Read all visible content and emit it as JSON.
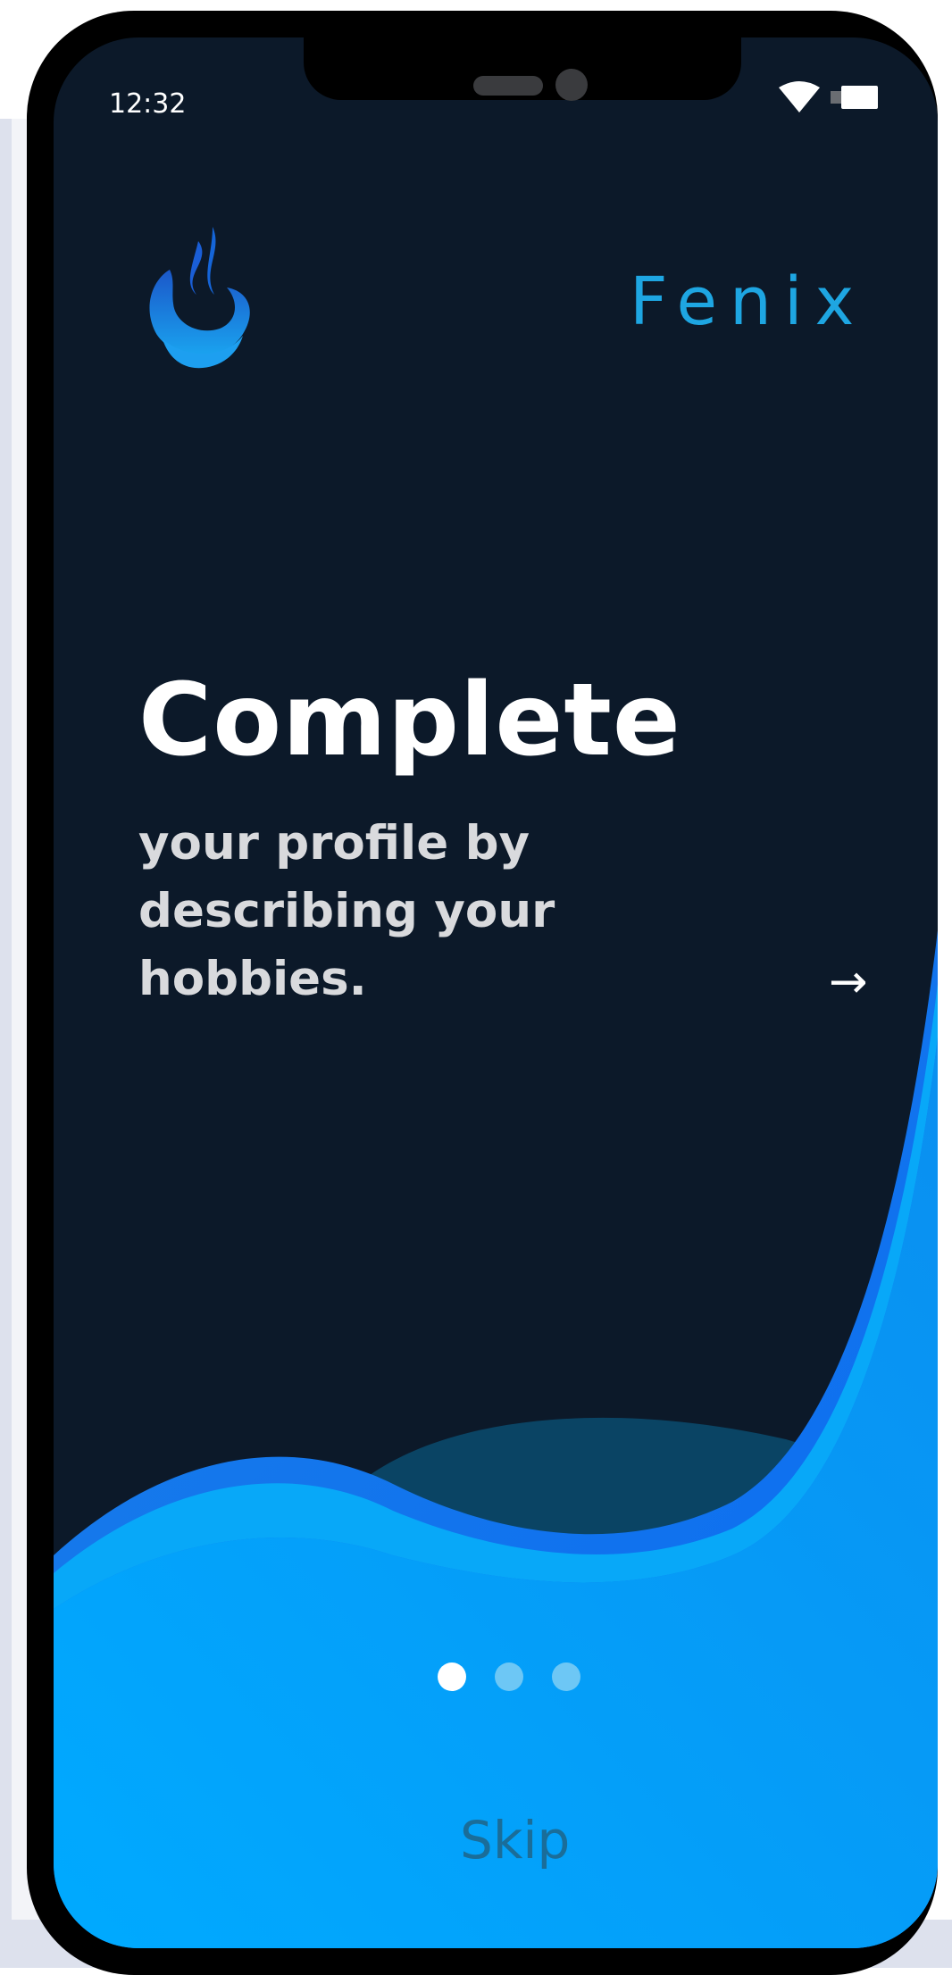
{
  "status_bar": {
    "time": "12:32"
  },
  "brand": {
    "name": "Fenix",
    "logo_icon": "flame-bowl-icon"
  },
  "onboarding": {
    "headline": "Complete",
    "body": "your profile by describing your hobbies.",
    "next_icon": "arrow-right-icon",
    "next_label": "→",
    "page_count": 3,
    "active_page": 1,
    "skip_label": "Skip"
  },
  "colors": {
    "background": "#0c1929",
    "brand_accent": "#1ea6e2",
    "wave_primary": "#0590f0",
    "wave_light": "#06aaff",
    "wave_dark": "#0a4464",
    "dot_active": "#ffffff",
    "dot_inactive": "#6dc7f5",
    "skip_text": "#1a6d99"
  }
}
